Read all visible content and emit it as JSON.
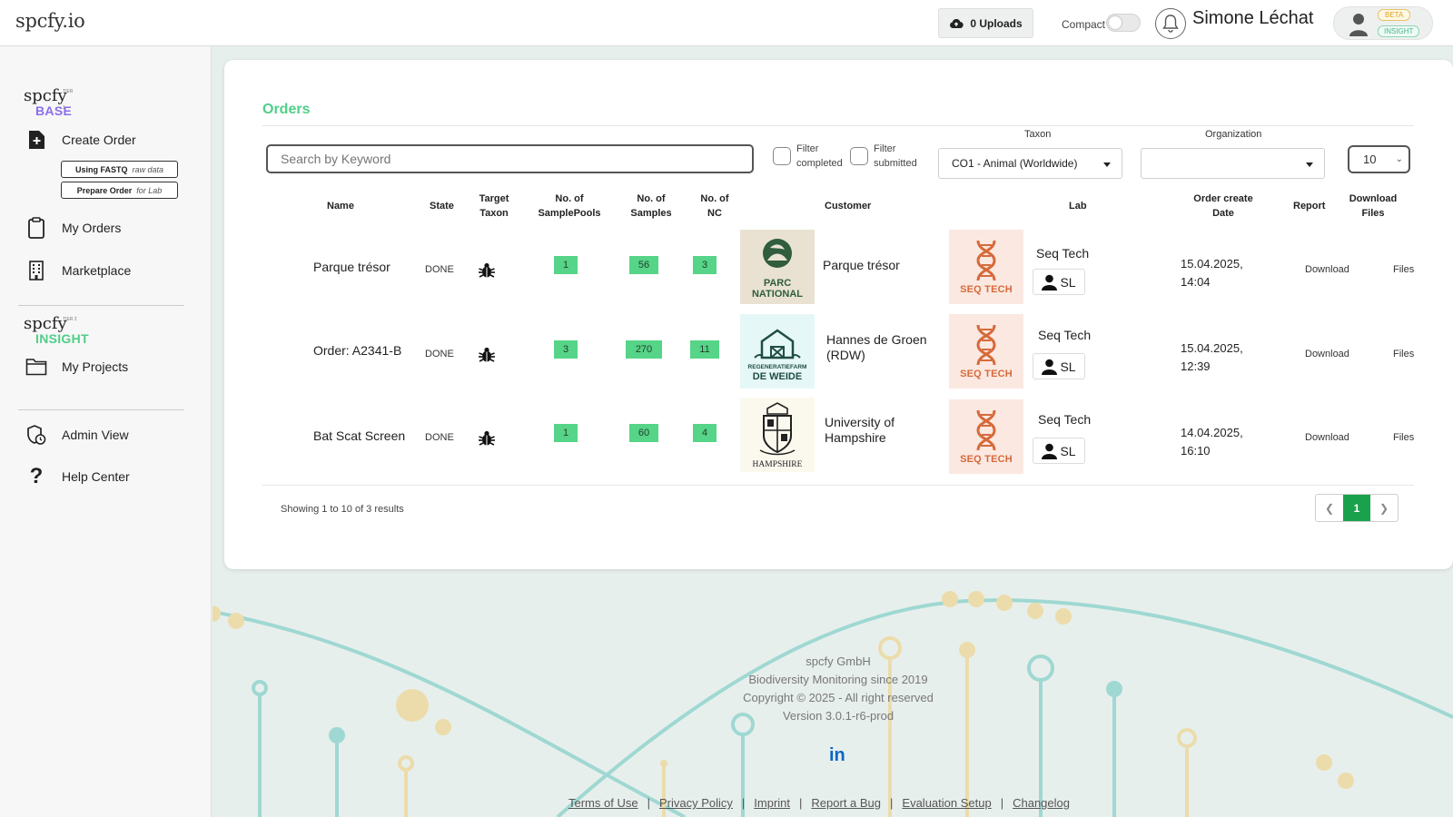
{
  "header": {
    "brand": "spcfy.io",
    "uploads_label": "0 Uploads",
    "compact_label": "Compact",
    "username": "Simone Léchat",
    "badge_beta": "BETA",
    "badge_insight": "INSIGHT"
  },
  "sidebar": {
    "base_logo": {
      "word": "spcfy",
      "tier": "TIER 1",
      "sub": "BASE",
      "sub_color": "#8a6fe8"
    },
    "insight_logo": {
      "word": "spcfy",
      "tier": "TIER 2",
      "sub": "INSIGHT",
      "sub_color": "#4fcf88"
    },
    "create_order": "Create Order",
    "sub_fastq": {
      "main": "Using FASTQ",
      "muted": "raw data"
    },
    "sub_prepare": {
      "main": "Prepare Order",
      "muted": "for Lab"
    },
    "my_orders": "My Orders",
    "marketplace": "Marketplace",
    "my_projects": "My Projects",
    "admin_view": "Admin View",
    "help_center": "Help Center"
  },
  "orders": {
    "title": "Orders",
    "search_placeholder": "Search by Keyword",
    "filter_completed": [
      "Filter",
      "completed"
    ],
    "filter_submitted": [
      "Filter",
      "submitted"
    ],
    "taxon_label": "Taxon",
    "taxon_value": "CO1 - Animal (Worldwide)",
    "organization_label": "Organization",
    "organization_value": "",
    "per_page": "10",
    "columns": {
      "name": "Name",
      "state": "State",
      "target_taxon": [
        "Target",
        "Taxon"
      ],
      "samplepools": [
        "No. of",
        "SamplePools"
      ],
      "samples": [
        "No. of",
        "Samples"
      ],
      "nc": [
        "No. of",
        "NC"
      ],
      "customer": "Customer",
      "lab": "Lab",
      "create_date": [
        "Order create",
        "Date"
      ],
      "report": "Report",
      "download": [
        "Download",
        "Files"
      ]
    },
    "rows": [
      {
        "name": "Parque trésor",
        "state": "DONE",
        "samplepools": "1",
        "samples": "56",
        "nc": "3",
        "customer": "Parque trésor",
        "customer_logo": {
          "line1": "PARC",
          "line2": "NATIONAL"
        },
        "lab": "Seq Tech",
        "lab_logo_text": "SEQ TECH",
        "lab_user": "SL",
        "date_line1": "15.04.2025,",
        "date_line2": "14:04",
        "report": "Download",
        "files": "Files"
      },
      {
        "name": "Order: A2341-B",
        "state": "DONE",
        "samplepools": "3",
        "samples": "270",
        "nc": "11",
        "customer": "Hannes de Groen",
        "customer_line2": "(RDW)",
        "customer_logo": {
          "line1": "REGENERATIEFARM",
          "line2": "DE WEIDE"
        },
        "lab": "Seq Tech",
        "lab_logo_text": "SEQ TECH",
        "lab_user": "SL",
        "date_line1": "15.04.2025,",
        "date_line2": "12:39",
        "report": "Download",
        "files": "Files"
      },
      {
        "name": "Bat Scat Screen",
        "state": "DONE",
        "samplepools": "1",
        "samples": "60",
        "nc": "4",
        "customer": "University of",
        "customer_line2": "Hampshire",
        "customer_logo": {
          "line1": "HAMPSHIRE"
        },
        "lab": "Seq Tech",
        "lab_logo_text": "SEQ TECH",
        "lab_user": "SL",
        "date_line1": "14.04.2025,",
        "date_line2": "16:10",
        "report": "Download",
        "files": "Files"
      }
    ],
    "showing": "Showing 1 to 10 of 3 results",
    "current_page": "1"
  },
  "footer": {
    "company": "spcfy GmbH",
    "tagline": "Biodiversity Monitoring since 2019",
    "copyright": "Copyright © 2025 - All right reserved",
    "version": "Version 3.0.1-r6-prod",
    "linkedin": "in",
    "links": [
      "Terms of Use",
      "Privacy Policy",
      "Imprint",
      "Report a Bug",
      "Evaluation Setup",
      "Changelog"
    ]
  }
}
